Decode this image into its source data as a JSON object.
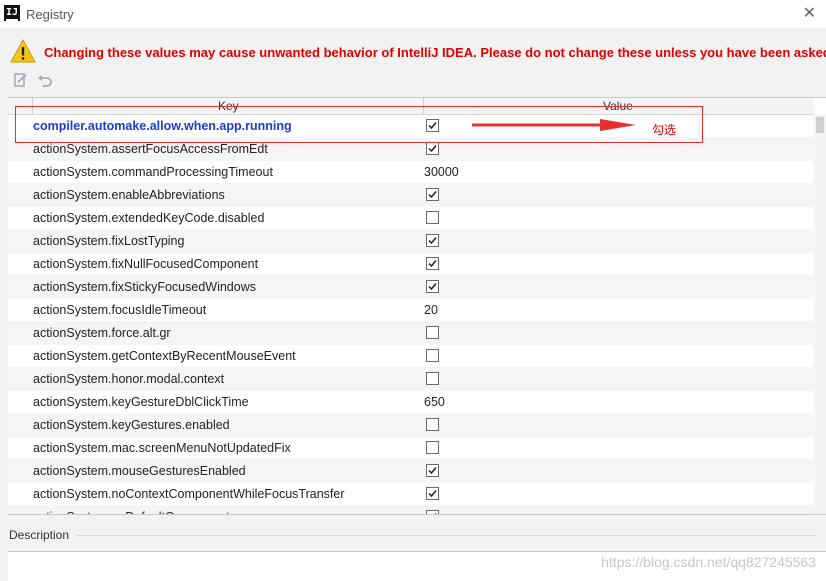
{
  "window": {
    "app_icon_text": "IJ",
    "title": "Registry",
    "close_glyph": "✕"
  },
  "warning": {
    "icon": "warning-triangle-icon",
    "text": "Changing these values may cause unwanted behavior of IntelliJ IDEA. Please do not change these unless you have been asked."
  },
  "toolbar": {
    "edit_icon": "edit-icon",
    "revert_icon": "revert-icon"
  },
  "table": {
    "columns": [
      "Key",
      "Value"
    ],
    "rows": [
      {
        "key": "compiler.automake.allow.when.app.running",
        "type": "bool",
        "value": true,
        "modified": true
      },
      {
        "key": "actionSystem.assertFocusAccessFromEdt",
        "type": "bool",
        "value": true
      },
      {
        "key": "actionSystem.commandProcessingTimeout",
        "type": "text",
        "value": "30000"
      },
      {
        "key": "actionSystem.enableAbbreviations",
        "type": "bool",
        "value": true
      },
      {
        "key": "actionSystem.extendedKeyCode.disabled",
        "type": "bool",
        "value": false
      },
      {
        "key": "actionSystem.fixLostTyping",
        "type": "bool",
        "value": true
      },
      {
        "key": "actionSystem.fixNullFocusedComponent",
        "type": "bool",
        "value": true
      },
      {
        "key": "actionSystem.fixStickyFocusedWindows",
        "type": "bool",
        "value": true
      },
      {
        "key": "actionSystem.focusIdleTimeout",
        "type": "text",
        "value": "20"
      },
      {
        "key": "actionSystem.force.alt.gr",
        "type": "bool",
        "value": false
      },
      {
        "key": "actionSystem.getContextByRecentMouseEvent",
        "type": "bool",
        "value": false
      },
      {
        "key": "actionSystem.honor.modal.context",
        "type": "bool",
        "value": false
      },
      {
        "key": "actionSystem.keyGestureDblClickTime",
        "type": "text",
        "value": "650"
      },
      {
        "key": "actionSystem.keyGestures.enabled",
        "type": "bool",
        "value": false
      },
      {
        "key": "actionSystem.mac.screenMenuNotUpdatedFix",
        "type": "bool",
        "value": false
      },
      {
        "key": "actionSystem.mouseGesturesEnabled",
        "type": "bool",
        "value": true
      },
      {
        "key": "actionSystem.noContextComponentWhileFocusTransfer",
        "type": "bool",
        "value": true
      },
      {
        "key": "actionSystem.noDefaultComponent",
        "type": "bool",
        "value": true
      }
    ]
  },
  "annotation": {
    "label": "勾选",
    "color": "#e00000"
  },
  "description": {
    "label": "Description"
  },
  "watermark": "https://blog.csdn.net/qq827245563"
}
